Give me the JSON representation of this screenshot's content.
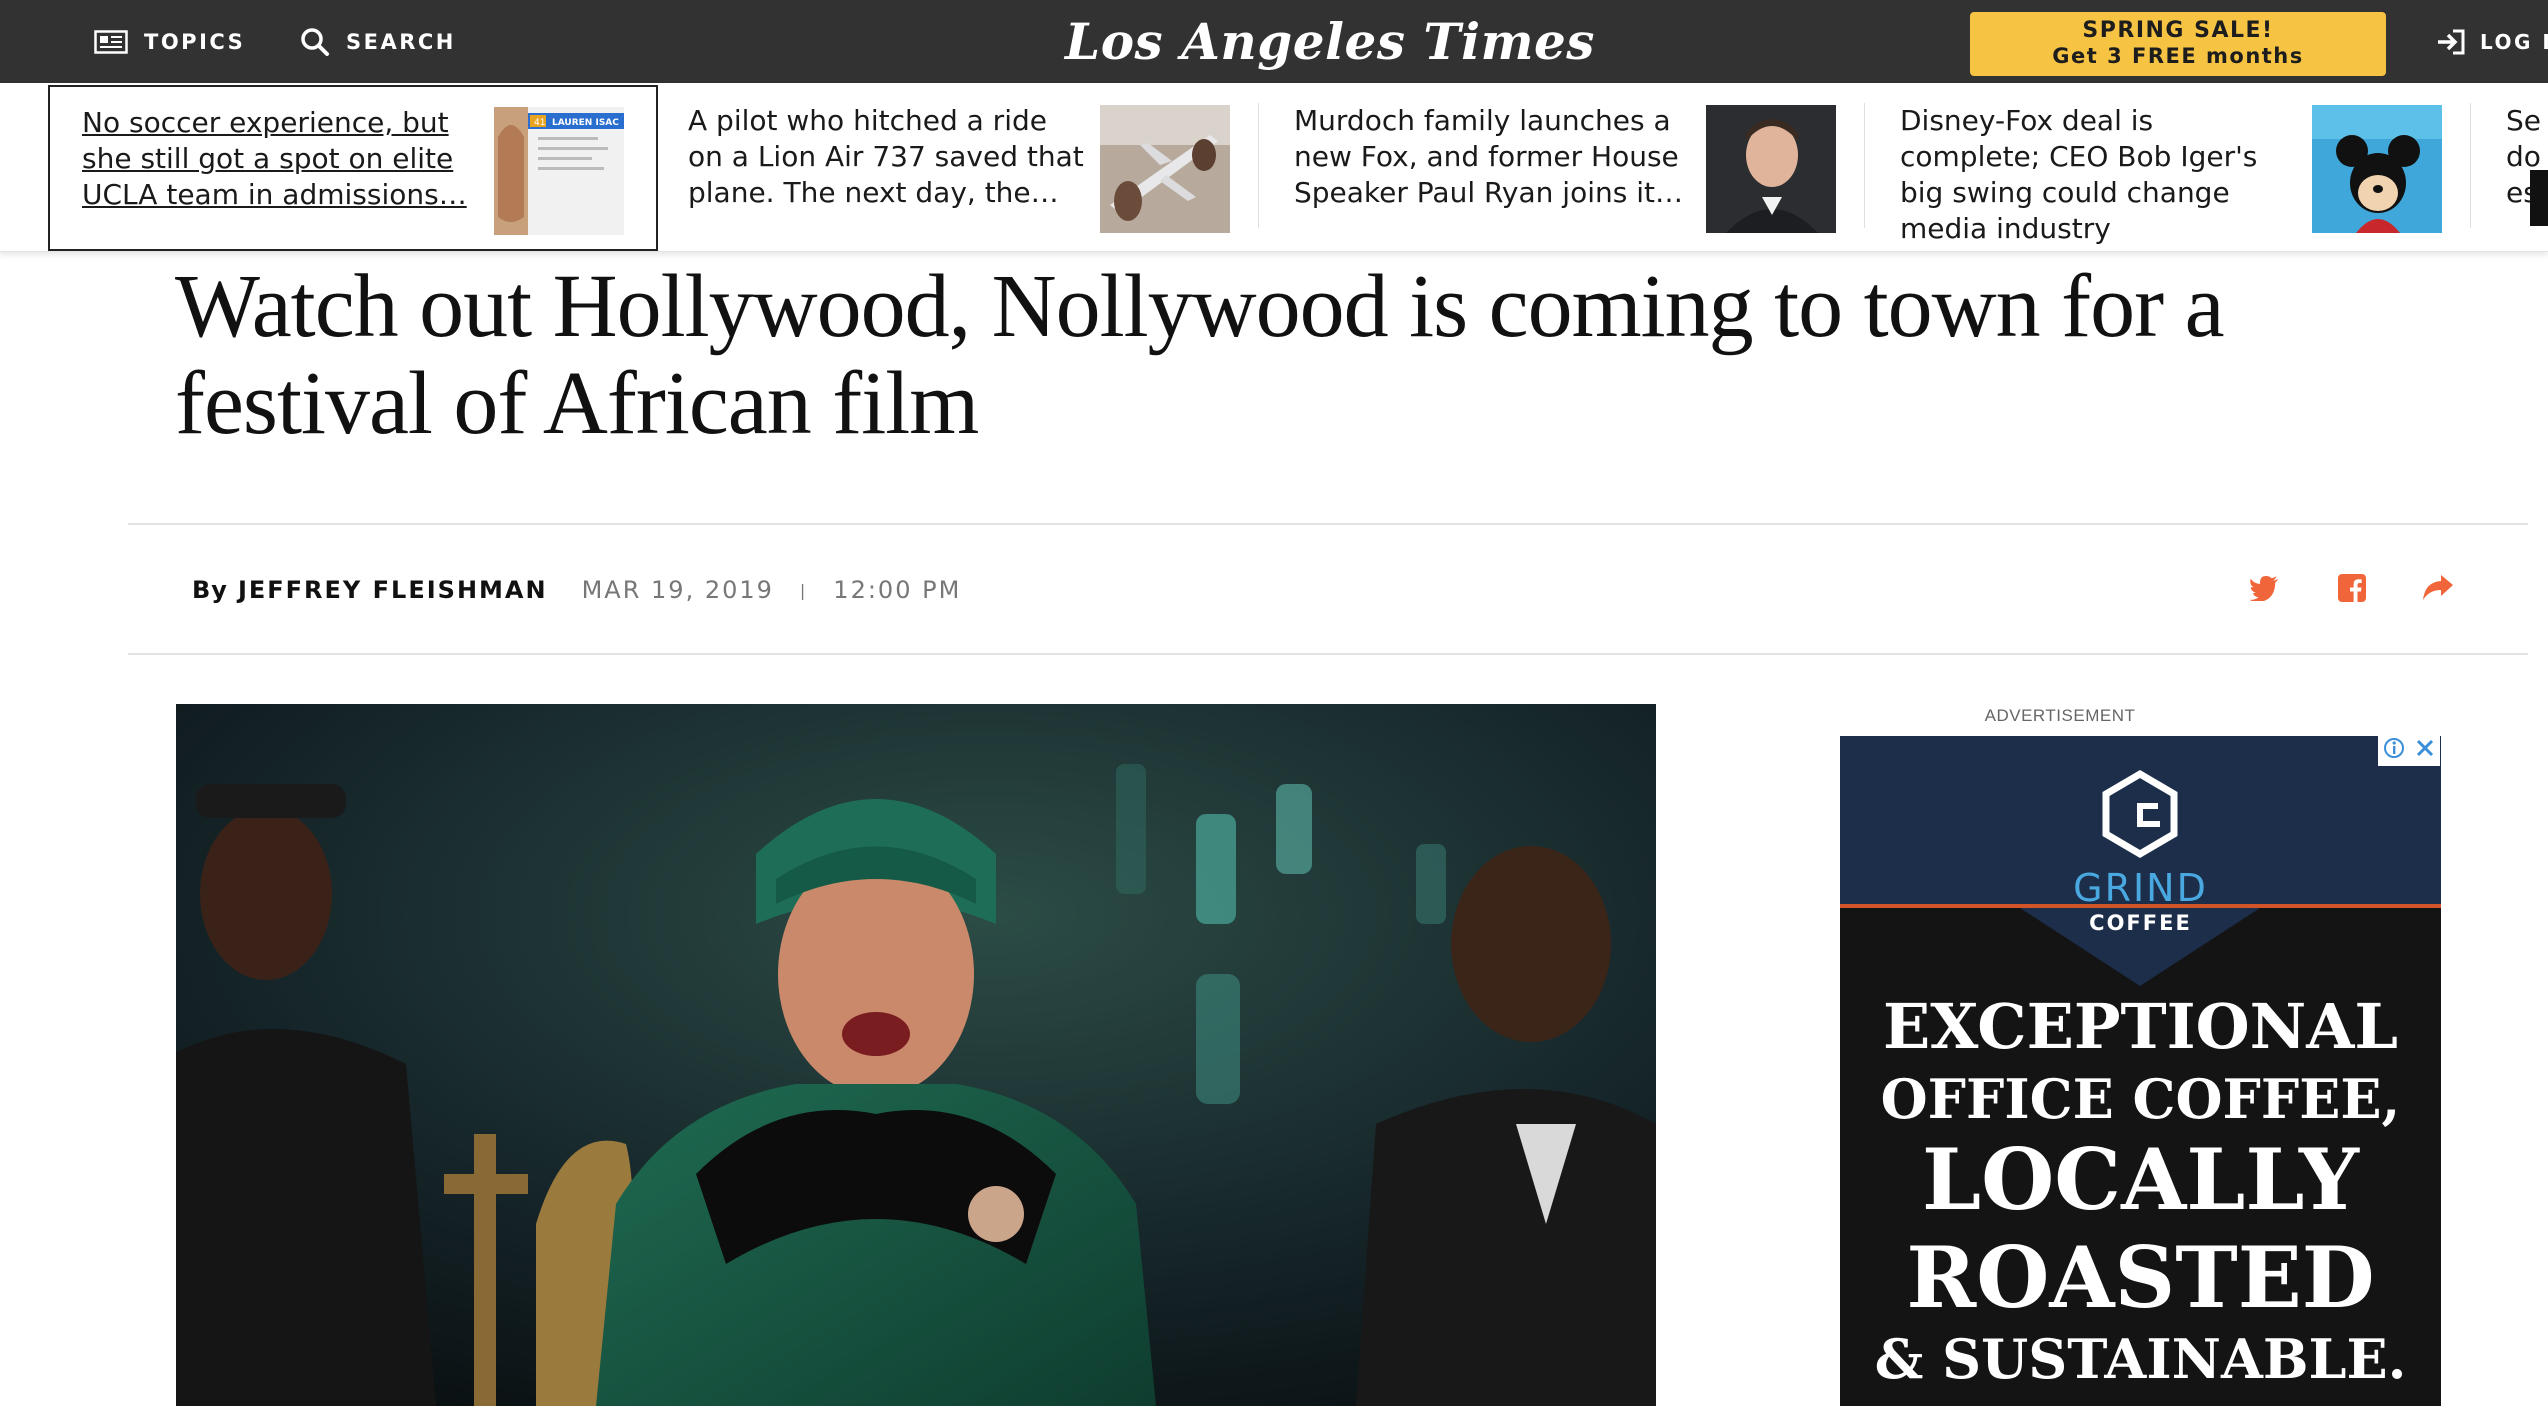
{
  "topbar": {
    "topics_label": "TOPICS",
    "search_label": "SEARCH",
    "masthead": "Los Angeles Times",
    "promo_line1": "SPRING SALE!",
    "promo_line2": "Get 3 FREE months",
    "login_label": "LOG IN"
  },
  "strip": {
    "items": [
      {
        "text": "No soccer experience, but she still got a spot on elite UCLA team in admissions…",
        "thumb": "application-form-image"
      },
      {
        "text": "A pilot who hitched a ride on a Lion Air 737 saved that plane. The next day, the…",
        "thumb": "airplane-model-image"
      },
      {
        "text": "Murdoch family launches a new Fox, and former House Speaker Paul Ryan joins it…",
        "thumb": "paul-ryan-portrait"
      },
      {
        "text": "Disney-Fox deal is complete; CEO Bob Iger's big swing could change media industry",
        "thumb": "mickey-mouse-image"
      },
      {
        "text": "Se do es",
        "thumb": ""
      }
    ],
    "thumb_caption": "LAUREN ISAC",
    "thumb_number": "41"
  },
  "article": {
    "headline": "Watch out Hollywood, Nollywood is coming to town for a festival of African film",
    "by": "By",
    "author": "JEFFREY FLEISHMAN",
    "date": "MAR 19, 2019",
    "separator": "|",
    "time": "12:00 PM"
  },
  "ad": {
    "label": "ADVERTISEMENT",
    "brand": "GRIND",
    "brand_sub": "COFFEE",
    "line1": "EXCEPTIONAL",
    "line2": "OFFICE COFFEE,",
    "line3": "LOCALLY",
    "line4": "ROASTED",
    "line5": "& SUSTAINABLE."
  },
  "colors": {
    "topbar": "#323232",
    "promo": "#f6c343",
    "share": "#f0653a",
    "ad_bg": "#141414",
    "ad_header": "#1c2e4a",
    "ad_accent": "#d2552a"
  }
}
